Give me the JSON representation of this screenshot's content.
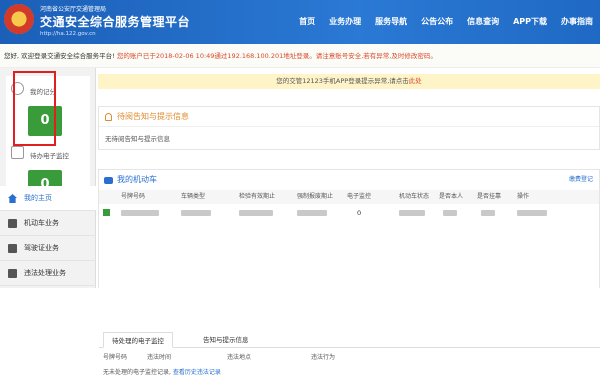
{
  "header": {
    "dept": "河南省公安厅交通管理局",
    "title": "交通安全综合服务管理平台",
    "url": "http://ha.122.gov.cn",
    "nav": [
      "首页",
      "业务办理",
      "服务导航",
      "公告公布",
      "信息查询",
      "APP下载",
      "办事指南"
    ]
  },
  "notice": {
    "greeting": "您好,",
    "welcome": "欢迎登录交通安全综合服务平台!",
    "warning": "您的账户已于2018-02-06 10:49通过192.168.100.201地址登录。请注意账号安全,若有异常,及时修改密码。"
  },
  "sidebar": {
    "points_label": "我的记分",
    "points_value": "0",
    "monitor_label": "待办电子监控",
    "monitor_value": "0",
    "menu": [
      "我的主页",
      "机动车业务",
      "驾驶证业务",
      "违法处理业务"
    ]
  },
  "app_notice": {
    "text": "您的交管12123手机APP登录提示异常,请点击",
    "link": "此处"
  },
  "alert_panel": {
    "title": "待阅告知与提示信息",
    "empty": "无待阅告知与提示信息"
  },
  "vehicle_panel": {
    "title": "我的机动车",
    "pay_link": "缴费登记",
    "columns": [
      "号牌号码",
      "车辆类型",
      "检验有效期止",
      "强制报废期止",
      "电子监控",
      "机动车状态",
      "是否本人",
      "是否挂靠",
      "操作"
    ],
    "row_monitor": "0"
  },
  "tabs": [
    "待处理的电子监控",
    "告知与提示信息"
  ],
  "violations": {
    "columns": [
      "号牌号码",
      "违法时间",
      "违法地点",
      "违法行为"
    ],
    "empty_text": "无未处理的电子监控记录,",
    "history_link": "查看历史违法记录"
  },
  "colors": {
    "header_blue": "#1f69c4",
    "badge_green": "#3a9b3a",
    "warning_red": "#d94a2a",
    "alert_orange": "#e08a2a"
  }
}
